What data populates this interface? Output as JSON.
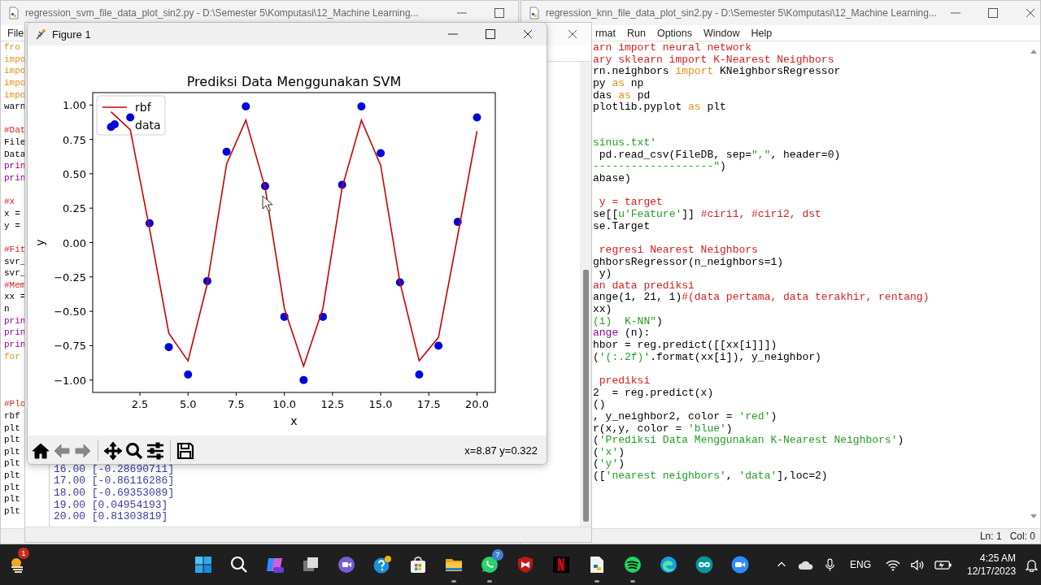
{
  "left_editor": {
    "title": "regression_svm_file_data_plot_sin2.py - D:\\Semester 5\\Komputasi\\12_Machine Learning...",
    "menu": [
      "File"
    ],
    "lines": [
      {
        "kind": "code",
        "segments": [
          {
            "text": "fro",
            "kind": "keyword"
          }
        ]
      },
      {
        "kind": "code",
        "segments": [
          {
            "text": "impo",
            "kind": "keyword"
          }
        ]
      },
      {
        "kind": "code",
        "segments": [
          {
            "text": "impo",
            "kind": "keyword"
          }
        ]
      },
      {
        "kind": "code",
        "segments": [
          {
            "text": "impo",
            "kind": "keyword"
          }
        ]
      },
      {
        "kind": "code",
        "segments": [
          {
            "text": "impo",
            "kind": "keyword"
          }
        ]
      },
      {
        "kind": "code",
        "segments": [
          {
            "text": "warn",
            "kind": "plain"
          }
        ]
      },
      {
        "kind": "blank"
      },
      {
        "kind": "code",
        "segments": [
          {
            "text": "#Dat",
            "kind": "comment"
          }
        ]
      },
      {
        "kind": "code",
        "segments": [
          {
            "text": "File",
            "kind": "plain"
          }
        ]
      },
      {
        "kind": "code",
        "segments": [
          {
            "text": "Data",
            "kind": "plain"
          }
        ]
      },
      {
        "kind": "code",
        "segments": [
          {
            "text": "prin",
            "kind": "builtin"
          }
        ]
      },
      {
        "kind": "code",
        "segments": [
          {
            "text": "prin",
            "kind": "builtin"
          }
        ]
      },
      {
        "kind": "blank"
      },
      {
        "kind": "code",
        "segments": [
          {
            "text": "#x",
            "kind": "comment"
          }
        ]
      },
      {
        "kind": "code",
        "segments": [
          {
            "text": "x =",
            "kind": "plain"
          }
        ]
      },
      {
        "kind": "code",
        "segments": [
          {
            "text": "y =",
            "kind": "plain"
          }
        ]
      },
      {
        "kind": "blank"
      },
      {
        "kind": "code",
        "segments": [
          {
            "text": "#Fit",
            "kind": "comment"
          }
        ]
      },
      {
        "kind": "code",
        "segments": [
          {
            "text": "svr_",
            "kind": "plain"
          }
        ]
      },
      {
        "kind": "code",
        "segments": [
          {
            "text": "svr_",
            "kind": "plain"
          }
        ]
      },
      {
        "kind": "code",
        "segments": [
          {
            "text": "#Mem",
            "kind": "comment"
          }
        ]
      },
      {
        "kind": "code",
        "segments": [
          {
            "text": "xx =",
            "kind": "plain"
          }
        ]
      },
      {
        "kind": "code",
        "segments": [
          {
            "text": "n",
            "kind": "plain"
          }
        ]
      },
      {
        "kind": "code",
        "segments": [
          {
            "text": "prin",
            "kind": "builtin"
          }
        ]
      },
      {
        "kind": "code",
        "segments": [
          {
            "text": "prin",
            "kind": "builtin"
          }
        ]
      },
      {
        "kind": "code",
        "segments": [
          {
            "text": "prin",
            "kind": "builtin"
          }
        ]
      },
      {
        "kind": "code",
        "segments": [
          {
            "text": "for",
            "kind": "keyword"
          }
        ]
      },
      {
        "kind": "blank"
      },
      {
        "kind": "blank"
      },
      {
        "kind": "blank"
      },
      {
        "kind": "code",
        "segments": [
          {
            "text": "#Plo",
            "kind": "comment"
          }
        ]
      },
      {
        "kind": "code",
        "segments": [
          {
            "text": "rbf",
            "kind": "plain"
          }
        ]
      },
      {
        "kind": "code",
        "segments": [
          {
            "text": "plt",
            "kind": "plain"
          }
        ]
      },
      {
        "kind": "code",
        "segments": [
          {
            "text": "plt",
            "kind": "plain"
          }
        ]
      },
      {
        "kind": "code",
        "segments": [
          {
            "text": "plt",
            "kind": "plain"
          }
        ]
      },
      {
        "kind": "code",
        "segments": [
          {
            "text": "plt",
            "kind": "plain"
          }
        ]
      },
      {
        "kind": "code",
        "segments": [
          {
            "text": "plt",
            "kind": "plain"
          }
        ]
      },
      {
        "kind": "code",
        "segments": [
          {
            "text": "plt",
            "kind": "plain"
          }
        ]
      },
      {
        "kind": "code",
        "segments": [
          {
            "text": "plt",
            "kind": "plain"
          }
        ]
      },
      {
        "kind": "code",
        "segments": [
          {
            "text": "plt",
            "kind": "plain"
          }
        ]
      }
    ]
  },
  "right_editor": {
    "title": "regression_knn_file_data_plot_sin2.py - D:\\Semester 5\\Komputasi\\12_Machine Learning...",
    "menu": [
      "rmat",
      "Run",
      "Options",
      "Window",
      "Help"
    ],
    "lines": [
      {
        "kind": "code",
        "segments": [
          {
            "text": "arn import neural network",
            "kind": "comment"
          }
        ]
      },
      {
        "kind": "code",
        "segments": [
          {
            "text": "ary sklearn import K-Nearest Neighbors",
            "kind": "comment"
          }
        ]
      },
      {
        "kind": "code",
        "segments": [
          {
            "text": "rn.neighbors ",
            "kind": "plain"
          },
          {
            "text": "import",
            "kind": "keyword"
          },
          {
            "text": " KNeighborsRegressor",
            "kind": "plain"
          }
        ]
      },
      {
        "kind": "code",
        "segments": [
          {
            "text": "py ",
            "kind": "plain"
          },
          {
            "text": "as",
            "kind": "keyword"
          },
          {
            "text": " np",
            "kind": "plain"
          }
        ]
      },
      {
        "kind": "code",
        "segments": [
          {
            "text": "das ",
            "kind": "plain"
          },
          {
            "text": "as",
            "kind": "keyword"
          },
          {
            "text": " pd",
            "kind": "plain"
          }
        ]
      },
      {
        "kind": "code",
        "segments": [
          {
            "text": "plotlib.pyplot ",
            "kind": "plain"
          },
          {
            "text": "as",
            "kind": "keyword"
          },
          {
            "text": " plt",
            "kind": "plain"
          }
        ]
      },
      {
        "kind": "blank"
      },
      {
        "kind": "blank"
      },
      {
        "kind": "code",
        "segments": [
          {
            "text": "sinus.txt'",
            "kind": "string"
          }
        ]
      },
      {
        "kind": "code",
        "segments": [
          {
            "text": " pd.read_csv(FileDB, sep=",
            "kind": "plain"
          },
          {
            "text": "\",\"",
            "kind": "string"
          },
          {
            "text": ", header=0)",
            "kind": "plain"
          }
        ]
      },
      {
        "kind": "code",
        "segments": [
          {
            "text": "-------------------\"",
            "kind": "string"
          },
          {
            "text": ")",
            "kind": "plain"
          }
        ]
      },
      {
        "kind": "code",
        "segments": [
          {
            "text": "abase)",
            "kind": "plain"
          }
        ]
      },
      {
        "kind": "blank"
      },
      {
        "kind": "code",
        "segments": [
          {
            "text": " y = target",
            "kind": "comment"
          }
        ]
      },
      {
        "kind": "code",
        "segments": [
          {
            "text": "se[[",
            "kind": "plain"
          },
          {
            "text": "u'Feature'",
            "kind": "string"
          },
          {
            "text": "]] ",
            "kind": "plain"
          },
          {
            "text": "#ciri1, #ciri2, dst",
            "kind": "comment"
          }
        ]
      },
      {
        "kind": "code",
        "segments": [
          {
            "text": "se.Target",
            "kind": "plain"
          }
        ]
      },
      {
        "kind": "blank"
      },
      {
        "kind": "code",
        "segments": [
          {
            "text": " regresi Nearest Neighbors",
            "kind": "comment"
          }
        ]
      },
      {
        "kind": "code",
        "segments": [
          {
            "text": "ghborsRegressor(n_neighbors=1)",
            "kind": "plain"
          }
        ]
      },
      {
        "kind": "code",
        "segments": [
          {
            "text": " y)",
            "kind": "plain"
          }
        ]
      },
      {
        "kind": "code",
        "segments": [
          {
            "text": "an data prediksi",
            "kind": "comment"
          }
        ]
      },
      {
        "kind": "code",
        "segments": [
          {
            "text": "ange(1, 21, 1)",
            "kind": "plain"
          },
          {
            "text": "#(data pertama, data terakhir, rentang)",
            "kind": "comment"
          }
        ]
      },
      {
        "kind": "code",
        "segments": [
          {
            "text": "xx)",
            "kind": "plain"
          }
        ]
      },
      {
        "kind": "code",
        "segments": [
          {
            "text": "(i)  K-NN\"",
            "kind": "string"
          },
          {
            "text": ")",
            "kind": "plain"
          }
        ]
      },
      {
        "kind": "code",
        "segments": [
          {
            "text": "ange",
            "kind": "builtin"
          },
          {
            "text": " (n):",
            "kind": "plain"
          }
        ]
      },
      {
        "kind": "code",
        "segments": [
          {
            "text": "hbor = reg.predict([[xx[i]]])",
            "kind": "plain"
          }
        ]
      },
      {
        "kind": "code",
        "segments": [
          {
            "text": "(",
            "kind": "plain"
          },
          {
            "text": "'(:.2f)'",
            "kind": "string"
          },
          {
            "text": ".format(xx[i]), y_neighbor)",
            "kind": "plain"
          }
        ]
      },
      {
        "kind": "blank"
      },
      {
        "kind": "code",
        "segments": [
          {
            "text": " prediksi",
            "kind": "comment"
          }
        ]
      },
      {
        "kind": "code",
        "segments": [
          {
            "text": "2  = reg.predict(x)",
            "kind": "plain"
          }
        ]
      },
      {
        "kind": "code",
        "segments": [
          {
            "text": "()",
            "kind": "plain"
          }
        ]
      },
      {
        "kind": "code",
        "segments": [
          {
            "text": ", y_neighbor2, color = ",
            "kind": "plain"
          },
          {
            "text": "'red'",
            "kind": "string"
          },
          {
            "text": ")",
            "kind": "plain"
          }
        ]
      },
      {
        "kind": "code",
        "segments": [
          {
            "text": "r(x,y, color = ",
            "kind": "plain"
          },
          {
            "text": "'blue'",
            "kind": "string"
          },
          {
            "text": ")",
            "kind": "plain"
          }
        ]
      },
      {
        "kind": "code",
        "segments": [
          {
            "text": "(",
            "kind": "plain"
          },
          {
            "text": "'Prediksi Data Menggunakan K-Nearest Neighbors'",
            "kind": "string"
          },
          {
            "text": ")",
            "kind": "plain"
          }
        ]
      },
      {
        "kind": "code",
        "segments": [
          {
            "text": "(",
            "kind": "plain"
          },
          {
            "text": "'x'",
            "kind": "string"
          },
          {
            "text": ")",
            "kind": "plain"
          }
        ]
      },
      {
        "kind": "code",
        "segments": [
          {
            "text": "(",
            "kind": "plain"
          },
          {
            "text": "'y'",
            "kind": "string"
          },
          {
            "text": ")",
            "kind": "plain"
          }
        ]
      },
      {
        "kind": "code",
        "segments": [
          {
            "text": "([",
            "kind": "plain"
          },
          {
            "text": "'nearest neighbors'",
            "kind": "string"
          },
          {
            "text": ", ",
            "kind": "plain"
          },
          {
            "text": "'data'",
            "kind": "string"
          },
          {
            "text": "],loc=2)",
            "kind": "plain"
          }
        ]
      }
    ],
    "status": [
      "Ln: 1",
      "Col: 0"
    ]
  },
  "shell": {
    "output": [
      "16.00 [-0.28690711]",
      "17.00 [-0.86116286]",
      "18.00 [-0.69353089]",
      "19.00 [0.04954193]",
      "20.00 [0.81303819]"
    ]
  },
  "figure": {
    "title": "Figure 1",
    "chart_data": {
      "type": "line",
      "title": "Prediksi Data Menggunakan SVM",
      "xlabel": "x",
      "ylabel": "y",
      "x": [
        1,
        2,
        3,
        4,
        5,
        6,
        7,
        8,
        9,
        10,
        11,
        12,
        13,
        14,
        15,
        16,
        17,
        18,
        19,
        20
      ],
      "series": [
        {
          "name": "rbf",
          "type": "line",
          "color": "#cc0000",
          "values": [
            0.95,
            0.82,
            0.1,
            -0.66,
            -0.86,
            -0.3,
            0.57,
            0.89,
            0.4,
            -0.48,
            -0.9,
            -0.48,
            0.4,
            0.89,
            0.56,
            -0.29,
            -0.86,
            -0.69,
            0.05,
            0.81
          ]
        },
        {
          "name": "data",
          "type": "scatter",
          "color": "#0000dd",
          "values": [
            0.84,
            0.91,
            0.14,
            -0.76,
            -0.96,
            -0.28,
            0.66,
            0.99,
            0.41,
            -0.54,
            -1.0,
            -0.54,
            0.42,
            0.99,
            0.65,
            -0.29,
            -0.96,
            -0.75,
            0.15,
            0.91
          ]
        }
      ],
      "legend": true,
      "xlim": [
        0.05,
        20.95
      ],
      "ylim": [
        -1.09,
        1.09
      ],
      "xticks": [
        {
          "value": 2.5,
          "label": "2.5"
        },
        {
          "value": 5,
          "label": "5.0"
        },
        {
          "value": 7.5,
          "label": "7.5"
        },
        {
          "value": 10,
          "label": "10.0"
        },
        {
          "value": 12.5,
          "label": "12.5"
        },
        {
          "value": 15,
          "label": "15.0"
        },
        {
          "value": 17.5,
          "label": "17.5"
        },
        {
          "value": 20,
          "label": "20.0"
        }
      ],
      "yticks": [
        {
          "value": -1,
          "label": "−1.00"
        },
        {
          "value": -0.75,
          "label": "−0.75"
        },
        {
          "value": -0.5,
          "label": "−0.50"
        },
        {
          "value": -0.25,
          "label": "−0.25"
        },
        {
          "value": 0,
          "label": "0.00"
        },
        {
          "value": 0.25,
          "label": "0.25"
        },
        {
          "value": 0.5,
          "label": "0.50"
        },
        {
          "value": 0.75,
          "label": "0.75"
        },
        {
          "value": 1,
          "label": "1.00"
        }
      ]
    },
    "toolbar": [
      {
        "kind": "home",
        "disabled": false
      },
      {
        "kind": "back",
        "disabled": true
      },
      {
        "kind": "forward",
        "disabled": true
      },
      {
        "kind": "separator"
      },
      {
        "kind": "pan",
        "disabled": false
      },
      {
        "kind": "zoom",
        "disabled": false
      },
      {
        "kind": "configure",
        "disabled": false
      },
      {
        "kind": "separator"
      },
      {
        "kind": "save",
        "disabled": false
      }
    ],
    "coordinates": "x=8.87 y=0.322"
  },
  "taskbar": {
    "widget": {
      "badge": "1"
    },
    "apps": [
      {
        "kind": "start",
        "running": false
      },
      {
        "kind": "search",
        "running": false
      },
      {
        "kind": "copilot",
        "running": false
      },
      {
        "kind": "taskview",
        "running": false
      },
      {
        "kind": "chat",
        "running": false
      },
      {
        "kind": "tips",
        "running": false
      },
      {
        "kind": "store",
        "running": false
      },
      {
        "kind": "folder",
        "running": true
      },
      {
        "kind": "whatsapp",
        "running": true,
        "badge": "7"
      },
      {
        "kind": "shield",
        "running": false
      },
      {
        "kind": "tile",
        "running": false
      },
      {
        "kind": "document",
        "running": true
      },
      {
        "kind": "music",
        "running": true
      },
      {
        "kind": "browser",
        "running": false
      },
      {
        "kind": "infinity",
        "running": false
      },
      {
        "kind": "video",
        "running": false
      }
    ],
    "language": "ENG",
    "time": "4:25 AM",
    "date": "12/17/2023"
  }
}
